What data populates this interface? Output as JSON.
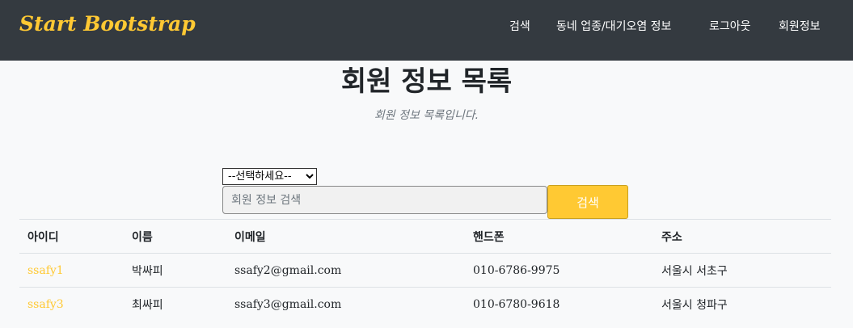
{
  "navbar": {
    "brand": "Start Bootstrap",
    "links": [
      "검색",
      "동네 업종/대기오염 정보",
      "로그아웃",
      "회원정보"
    ]
  },
  "page": {
    "title": "회원 정보 목록",
    "subtitle": "회원 정보 목록입니다."
  },
  "search": {
    "select_value": "--선택하세요--",
    "placeholder": "회원 정보 검색",
    "button_label": "검색"
  },
  "table": {
    "headers": [
      "아이디",
      "이름",
      "이메일",
      "핸드폰",
      "주소"
    ],
    "rows": [
      [
        "ssafy1",
        "박싸피",
        "ssafy2@gmail.com",
        "010-6786-9975",
        "서울시 서초구"
      ],
      [
        "ssafy3",
        "최싸피",
        "ssafy3@gmail.com",
        "010-6780-9618",
        "서울시 청파구"
      ]
    ]
  },
  "colors": {
    "navbar_bg": "#343a40",
    "accent": "#ffc933",
    "page_bg": "#f8f9fa"
  }
}
